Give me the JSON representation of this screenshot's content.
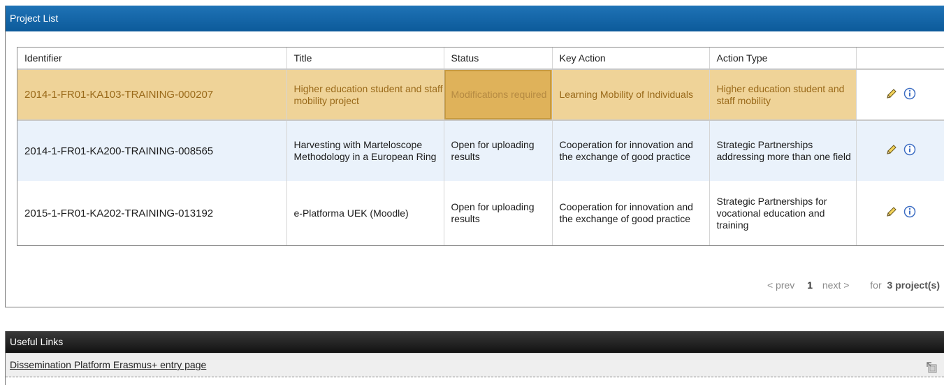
{
  "project_panel": {
    "title": "Project List"
  },
  "table": {
    "columns": [
      "Identifier",
      "Title",
      "Status",
      "Key Action",
      "Action Type",
      ""
    ],
    "rows": [
      {
        "identifier": "2014-1-FR01-KA103-TRAINING-000207",
        "title": "Higher education student and staff mobility project",
        "status": "Modifications required",
        "key_action": "Learning Mobility of Individuals",
        "action_type": "Higher education student and staff mobility"
      },
      {
        "identifier": "2014-1-FR01-KA200-TRAINING-008565",
        "title": "Harvesting with Marteloscope Methodology in a European Ring",
        "status": "Open for uploading results",
        "key_action": "Cooperation for innovation and the exchange of good practice",
        "action_type": "Strategic Partnerships addressing more than one field"
      },
      {
        "identifier": "2015-1-FR01-KA202-TRAINING-013192",
        "title": "e-Platforma UEK (Moodle)",
        "status": "Open for uploading results",
        "key_action": "Cooperation for innovation and the exchange of good practice",
        "action_type": "Strategic Partnerships for vocational education and training"
      }
    ],
    "row_icons": [
      "pencil-icon",
      "info-icon"
    ]
  },
  "pager": {
    "prev": "< prev",
    "page": "1",
    "next": "next >",
    "for_label": "for",
    "count": "3 project(s)"
  },
  "links_panel": {
    "title": "Useful Links",
    "items": [
      {
        "label": "Dissemination Platform Erasmus+ entry page",
        "icon": "external-link-icon"
      }
    ]
  },
  "colors": {
    "header_blue": "#0c5a9a",
    "highlight_row": "#efd398",
    "status_highlight": "#dfb25a",
    "alt_row": "#eaf2fb",
    "links_header": "#121212"
  }
}
